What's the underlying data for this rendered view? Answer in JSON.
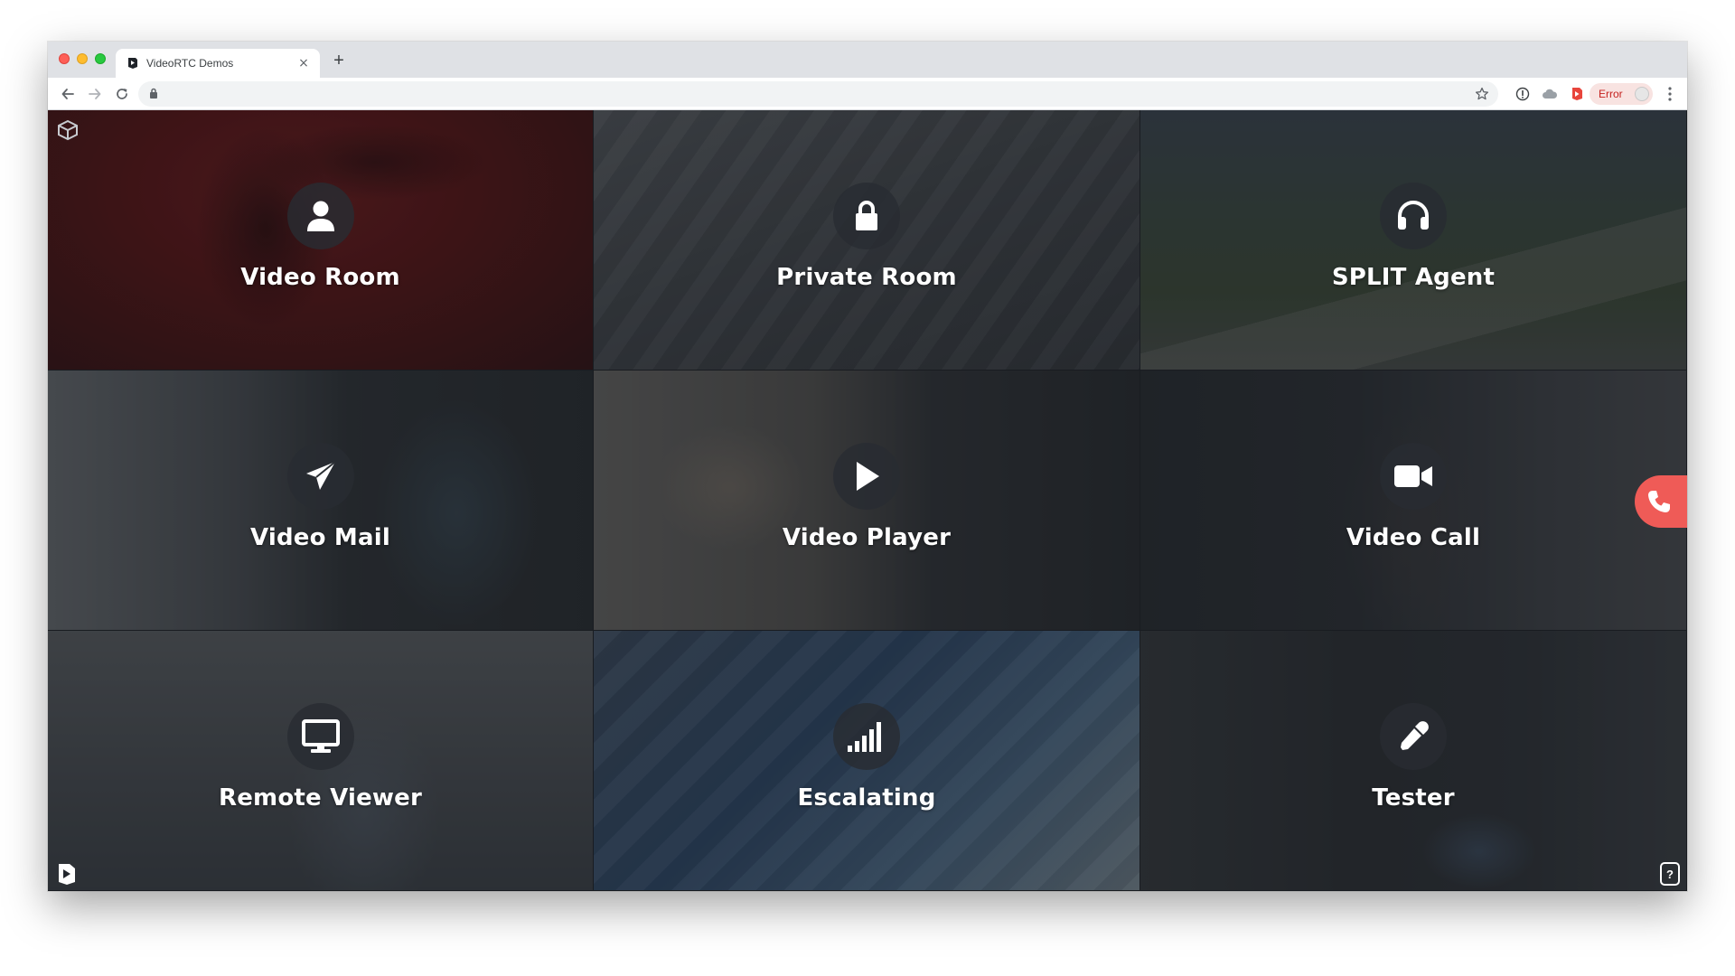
{
  "browser": {
    "tab_title": "VideoRTC Demos",
    "tab_close": "×",
    "new_tab": "+",
    "address": "",
    "error_badge": "Error"
  },
  "tiles": [
    {
      "label": "Video Room",
      "icon": "user-icon"
    },
    {
      "label": "Private Room",
      "icon": "lock-icon"
    },
    {
      "label": "SPLIT Agent",
      "icon": "headphones-icon"
    },
    {
      "label": "Video Mail",
      "icon": "paper-plane-icon"
    },
    {
      "label": "Video Player",
      "icon": "play-icon"
    },
    {
      "label": "Video Call",
      "icon": "video-camera-icon"
    },
    {
      "label": "Remote Viewer",
      "icon": "monitor-icon"
    },
    {
      "label": "Escalating",
      "icon": "signal-bars-icon"
    },
    {
      "label": "Tester",
      "icon": "eyedropper-icon"
    }
  ],
  "help": "?",
  "colors": {
    "call_button": "#ef5b57",
    "error_text": "#c5221f"
  }
}
